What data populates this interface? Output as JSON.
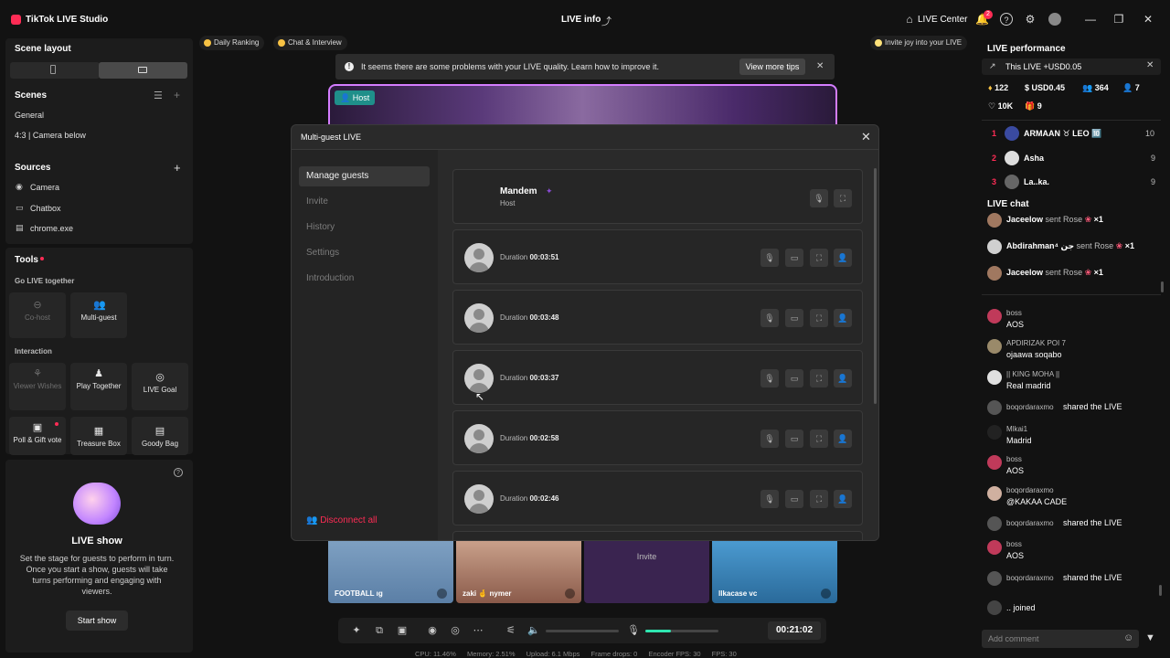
{
  "app": {
    "title": "TikTok LIVE Studio",
    "center_title": "LIVE info",
    "live_center": "LIVE Center",
    "notif_count": "2"
  },
  "left": {
    "scene_layout": "Scene layout",
    "scenes_title": "Scenes",
    "scenes": [
      "General",
      "4:3 | Camera below"
    ],
    "sources_title": "Sources",
    "sources": [
      "Camera",
      "Chatbox",
      "chrome.exe"
    ],
    "tools_title": "Tools",
    "go_live_together": "Go LIVE together",
    "cohost": "Co-host",
    "multiguest": "Multi-guest",
    "interaction": "Interaction",
    "viewer_wishes": "Viewer Wishes",
    "play_together": "Play Together",
    "live_goal": "LIVE Goal",
    "poll_gift": "Poll & Gift vote",
    "treasure_box": "Treasure Box",
    "goody_bag": "Goody Bag",
    "liveshow_title": "LIVE show",
    "liveshow_desc": "Set the stage for guests to perform in turn. Once you start a show, guests will take turns performing and engaging with viewers.",
    "start_show": "Start show"
  },
  "center": {
    "chip_daily": "Daily Ranking",
    "chip_chat": "Chat & Interview",
    "chip_invite": "Invite joy into your LIVE",
    "banner_text": "It seems there are some problems with your LIVE quality. Learn how to improve it.",
    "banner_button": "View more tips",
    "host_tag": "Host"
  },
  "dialog": {
    "title": "Multi-guest LIVE",
    "nav": [
      "Manage guests",
      "Invite",
      "History",
      "Settings",
      "Introduction"
    ],
    "disconnect_all": "Disconnect all",
    "host_name": "Mandem",
    "host_role": "Host",
    "duration_label": "Duration",
    "guests": [
      "00:03:51",
      "00:03:48",
      "00:03:37",
      "00:02:58",
      "00:02:46"
    ]
  },
  "strip": {
    "thumbs": [
      "FOOTBALL ıɡ",
      "zaki 🤞 nymer",
      "",
      "llkacase vc"
    ],
    "invite": "Invite"
  },
  "controls": {
    "timer": "00:21:02",
    "volume_level": 0.35
  },
  "stats": {
    "cpu": "CPU: 11.46%",
    "memory": "Memory: 2.51%",
    "upload": "Upload: 6.1 Mbps",
    "frame_drops": "Frame drops: 0",
    "encoder_fps": "Encoder FPS: 30",
    "fps": "FPS: 30"
  },
  "right": {
    "performance_title": "LIVE performance",
    "this_live": "This LIVE +USD0.05",
    "m_diamonds": "122",
    "m_usd": "USD0.45",
    "m_viewers": "364",
    "m_gifters": "7",
    "m_likes": "10K",
    "m_gifts": "9",
    "ranking": [
      {
        "rank": "1",
        "name": "ARMAAN ♉ LEO 🔟",
        "score": "10"
      },
      {
        "rank": "2",
        "name": "Asha",
        "score": "9"
      },
      {
        "rank": "3",
        "name": "La..ka.",
        "score": "9"
      }
    ],
    "live_chat_title": "LIVE chat",
    "gifts": [
      {
        "name": "Jaceelow",
        "text": "sent Rose",
        "count": "×1"
      },
      {
        "name": "Abdirahman⁴ جن",
        "text": "sent Rose",
        "count": "×1"
      },
      {
        "name": "Jaceelow",
        "text": "sent Rose",
        "count": "×1"
      }
    ],
    "chat": [
      {
        "name": "boss",
        "msg": "AOS"
      },
      {
        "name": "APDIRIZAK POI 7",
        "msg": "ojaawa soqabo"
      },
      {
        "name": "|| KING MOHA ||",
        "msg": "Real madrid"
      },
      {
        "name": "boqordaraxmo",
        "msg": "shared the LIVE"
      },
      {
        "name": "Mlkai1",
        "msg": "Madrid"
      },
      {
        "name": "boss",
        "msg": "AOS"
      },
      {
        "name": "boqordaraxmo",
        "msg": "@KAKAA CADE"
      },
      {
        "name": "boqordaraxmo",
        "msg": "shared the LIVE"
      },
      {
        "name": "boss",
        "msg": "AOS"
      },
      {
        "name": "boqordaraxmo",
        "msg": "shared the LIVE"
      }
    ],
    "joined": ".. joined",
    "add_comment": "Add comment"
  }
}
